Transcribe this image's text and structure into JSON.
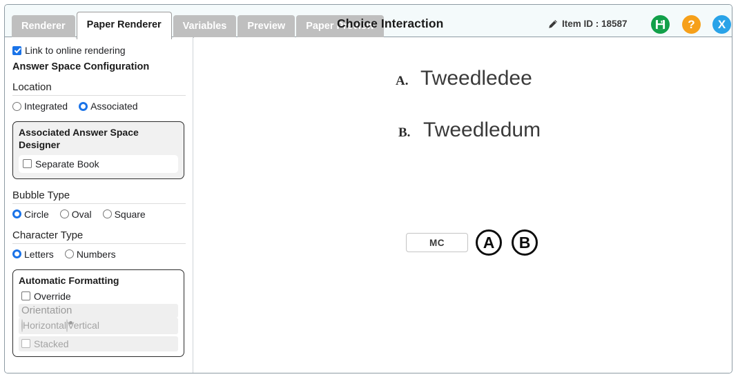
{
  "header": {
    "title": "Choice Interaction",
    "item_id_label": "Item ID : 18587",
    "pencil_icon": "pencil-icon",
    "icons": [
      {
        "name": "save-icon",
        "glyph": "",
        "color": "#12a04a"
      },
      {
        "name": "help-icon",
        "glyph": "?",
        "color": "#f6a01a"
      },
      {
        "name": "close-icon",
        "glyph": "X",
        "color": "#29a3e8"
      }
    ]
  },
  "tabs": [
    {
      "label": "Renderer",
      "active": false
    },
    {
      "label": "Paper Renderer",
      "active": true
    },
    {
      "label": "Variables",
      "active": false
    },
    {
      "label": "Preview",
      "active": false
    },
    {
      "label": "Paper Preview",
      "active": false
    }
  ],
  "sidebar": {
    "link_online": {
      "label": "Link to online rendering",
      "checked": true
    },
    "config_heading": "Answer Space Configuration",
    "location": {
      "heading": "Location",
      "options": [
        {
          "label": "Integrated",
          "selected": false
        },
        {
          "label": "Associated",
          "selected": true
        }
      ]
    },
    "associated_box": {
      "title": "Associated Answer Space Designer",
      "separate_book": {
        "label": "Separate Book",
        "checked": false
      }
    },
    "bubble_type": {
      "heading": "Bubble Type",
      "options": [
        {
          "label": "Circle",
          "selected": true
        },
        {
          "label": "Oval",
          "selected": false
        },
        {
          "label": "Square",
          "selected": false
        }
      ]
    },
    "character_type": {
      "heading": "Character Type",
      "options": [
        {
          "label": "Letters",
          "selected": true
        },
        {
          "label": "Numbers",
          "selected": false
        }
      ]
    },
    "automatic_formatting": {
      "title": "Automatic Formatting",
      "override": {
        "label": "Override",
        "checked": false
      },
      "orientation_heading": "Orientation",
      "orientation_options": [
        {
          "label": "Horizontal",
          "selected": false
        },
        {
          "label": "Vertical",
          "selected": true
        }
      ],
      "stacked": {
        "label": "Stacked",
        "checked": false
      }
    }
  },
  "main": {
    "choices": [
      {
        "letter": "A.",
        "text": "Tweedledee"
      },
      {
        "letter": "B.",
        "text": "Tweedledum"
      }
    ],
    "answer_space": {
      "type_label": "MC",
      "bubbles": [
        "A",
        "B"
      ]
    }
  }
}
